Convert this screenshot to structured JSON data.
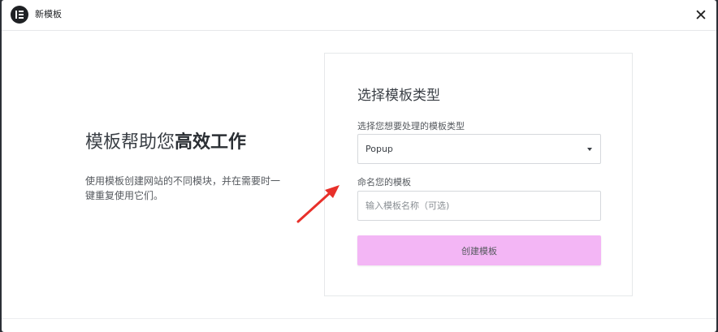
{
  "header": {
    "title": "新模板",
    "close_symbol": "✕"
  },
  "intro": {
    "title_prefix": "模板帮助您",
    "title_bold": "高效工作",
    "description": "使用模板创建网站的不同模块，并在需要时一键重复使用它们。"
  },
  "form": {
    "title": "选择模板类型",
    "type_label": "选择您想要处理的模板类型",
    "type_selected": "Popup",
    "name_label": "命名您的模板",
    "name_placeholder": "输入模板名称（可选)",
    "name_value": "",
    "submit_label": "创建模板"
  },
  "colors": {
    "accent": "#f3b6f5",
    "annotation_arrow": "#e8302a"
  },
  "icons": {
    "logo": "elementor-logo-icon",
    "close": "close-icon",
    "caret": "caret-down-icon",
    "annotation": "red-arrow-icon"
  }
}
